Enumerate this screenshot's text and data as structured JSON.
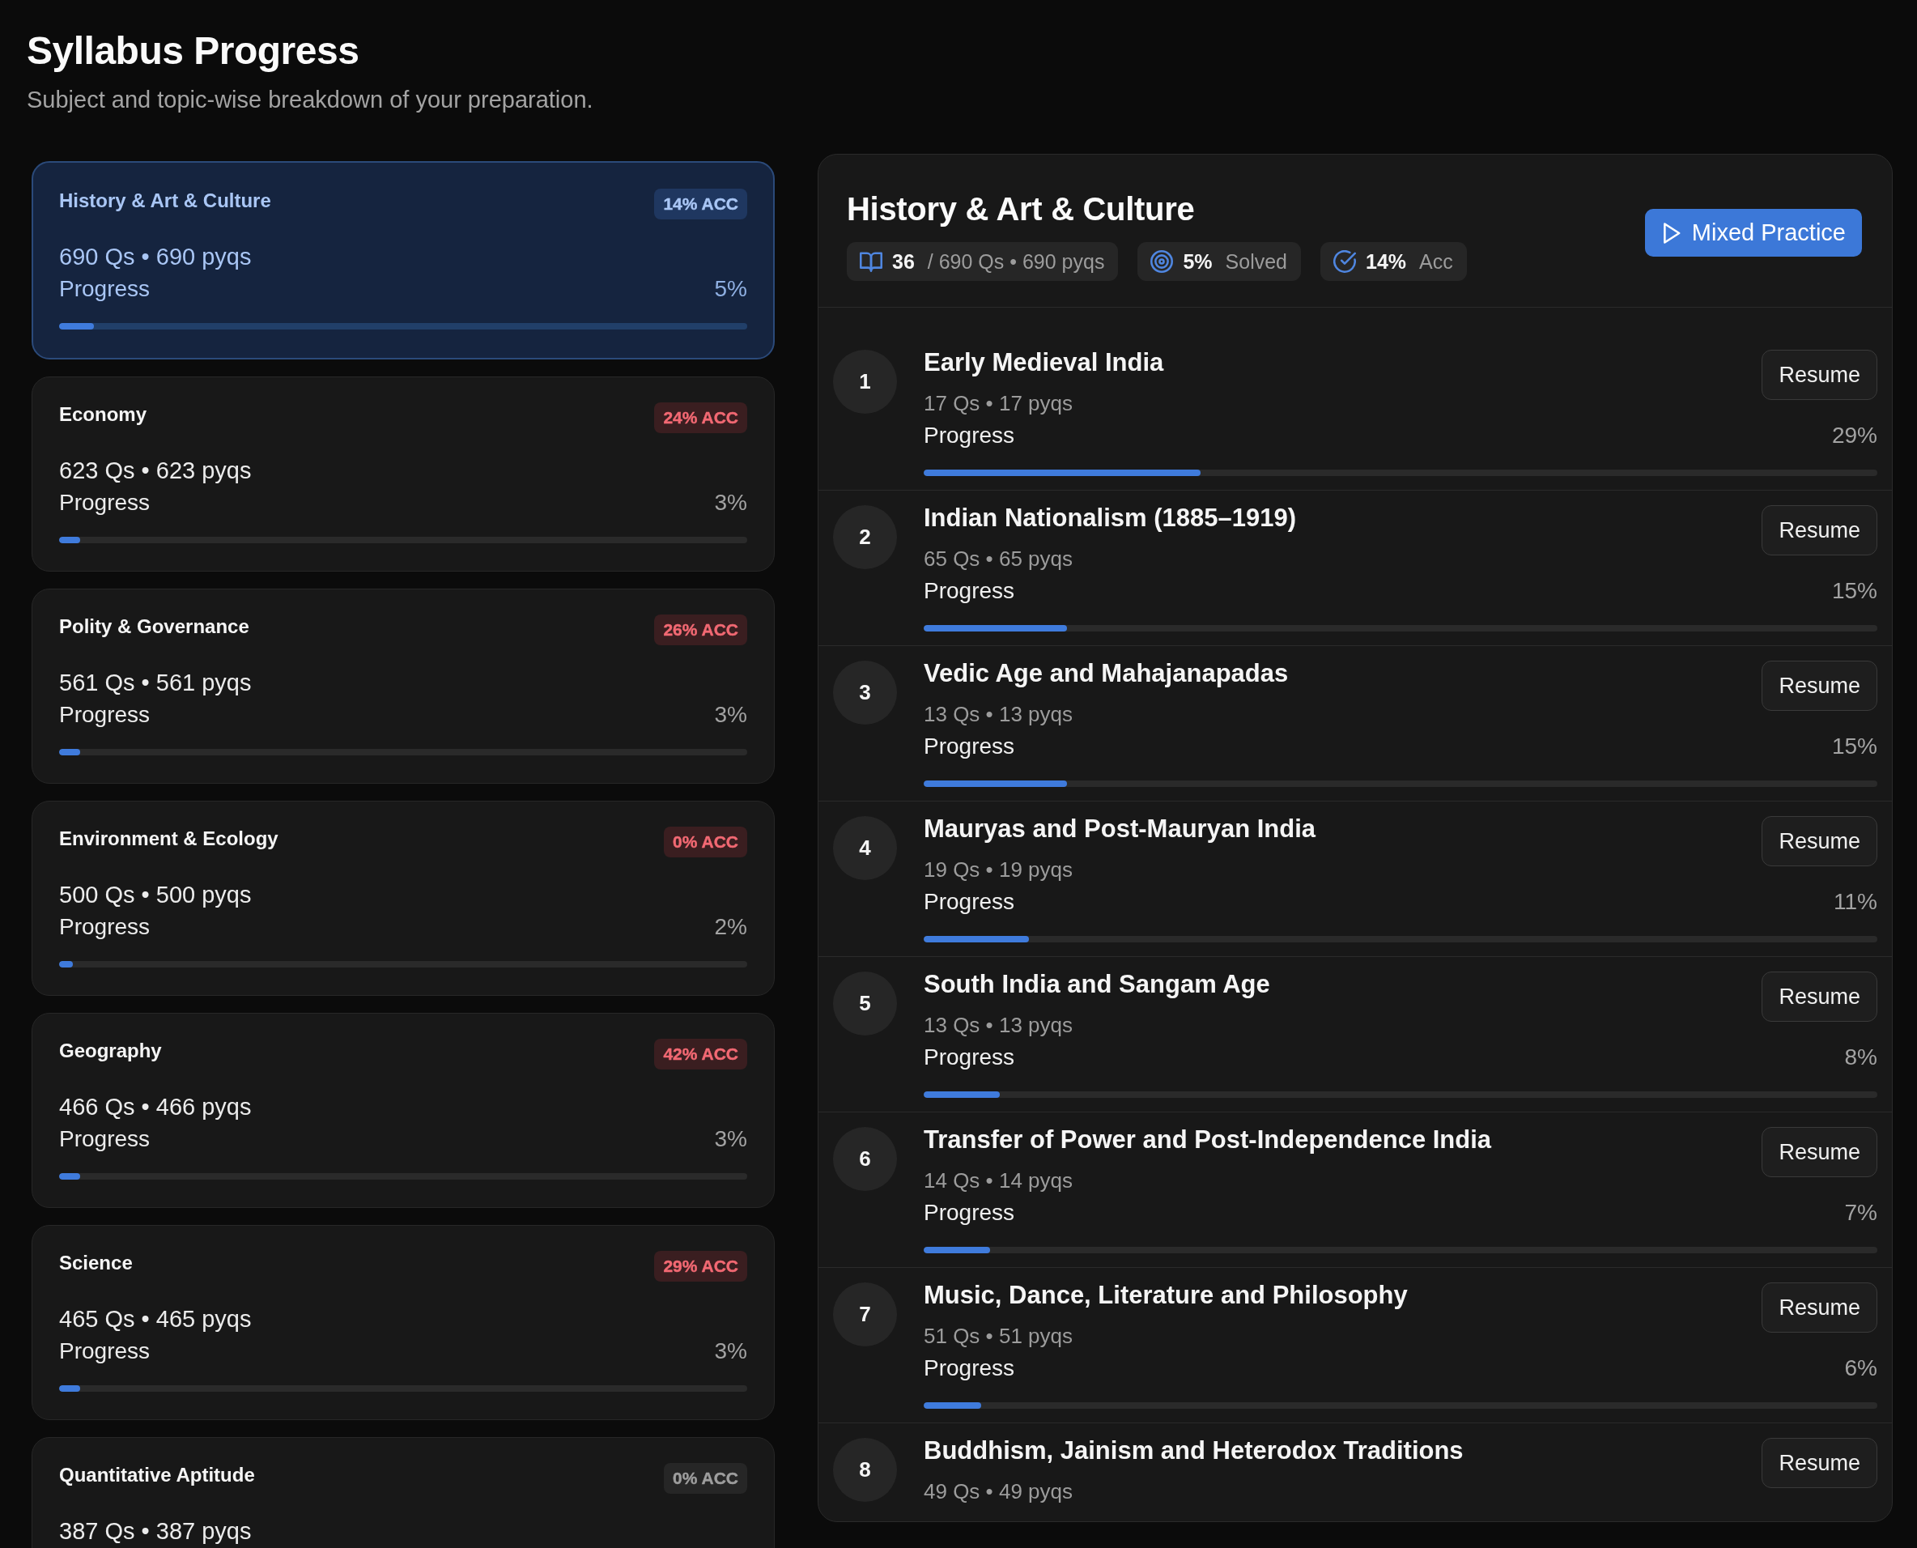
{
  "page": {
    "title": "Syllabus Progress",
    "subtitle": "Subject and topic-wise breakdown of your preparation."
  },
  "subjects": [
    {
      "name": "History & Art & Culture",
      "selected": true,
      "accuracy": {
        "text": "14% ACC",
        "color": "#1f3760"
      },
      "counts": "690 Qs • 690 pyqs",
      "progress_label": "Progress",
      "progress_value": "5%",
      "level": 0.05
    },
    {
      "name": "Economy",
      "selected": false,
      "accuracy": {
        "text": "24% ACC",
        "color": "#3a1e20"
      },
      "counts": "623 Qs • 623 pyqs",
      "progress_label": "Progress",
      "progress_value": "3%",
      "level": 0.03
    },
    {
      "name": "Polity & Governance",
      "selected": false,
      "accuracy": {
        "text": "26% ACC",
        "color": "#3a1e20"
      },
      "counts": "561 Qs • 561 pyqs",
      "progress_label": "Progress",
      "progress_value": "3%",
      "level": 0.03
    },
    {
      "name": "Environment & Ecology",
      "selected": false,
      "accuracy": {
        "text": "0% ACC",
        "color": "#3a1e20"
      },
      "counts": "500 Qs • 500 pyqs",
      "progress_label": "Progress",
      "progress_value": "2%",
      "level": 0.02
    },
    {
      "name": "Geography",
      "selected": false,
      "accuracy": {
        "text": "42% ACC",
        "color": "#3a1e20"
      },
      "counts": "466 Qs • 466 pyqs",
      "progress_label": "Progress",
      "progress_value": "3%",
      "level": 0.03
    },
    {
      "name": "Science",
      "selected": false,
      "accuracy": {
        "text": "29% ACC",
        "color": "#3a1e20"
      },
      "counts": "465 Qs • 465 pyqs",
      "progress_label": "Progress",
      "progress_value": "3%",
      "level": 0.03
    },
    {
      "name": "Quantitative Aptitude",
      "selected": false,
      "accuracy": {
        "text": "0% ACC",
        "color": "#262626"
      },
      "counts": "387 Qs • 387 pyqs"
    }
  ],
  "detail": {
    "title": "History & Art & Culture",
    "stats": [
      {
        "kind": "questions",
        "value": "36",
        "label": "/ 690 Qs • 690 pyqs"
      },
      {
        "kind": "solved",
        "value": "5%",
        "label": "Solved"
      },
      {
        "kind": "accuracy",
        "value": "14%",
        "label": "Acc"
      }
    ],
    "action": "Mixed Practice",
    "topics": [
      {
        "number": "1",
        "title": "Early Medieval India",
        "counts": "17 Qs • 17 pyqs",
        "progress_label": "Progress",
        "progress_value": "29%",
        "level": 0.29,
        "button": "Resume"
      },
      {
        "number": "2",
        "title": "Indian Nationalism (1885–1919)",
        "counts": "65 Qs • 65 pyqs",
        "progress_label": "Progress",
        "progress_value": "15%",
        "level": 0.15,
        "button": "Resume"
      },
      {
        "number": "3",
        "title": "Vedic Age and Mahajanapadas",
        "counts": "13 Qs • 13 pyqs",
        "progress_label": "Progress",
        "progress_value": "15%",
        "level": 0.15,
        "button": "Resume"
      },
      {
        "number": "4",
        "title": "Mauryas and Post-Mauryan India",
        "counts": "19 Qs • 19 pyqs",
        "progress_label": "Progress",
        "progress_value": "11%",
        "level": 0.11,
        "button": "Resume"
      },
      {
        "number": "5",
        "title": "South India and Sangam Age",
        "counts": "13 Qs • 13 pyqs",
        "progress_label": "Progress",
        "progress_value": "8%",
        "level": 0.08,
        "button": "Resume"
      },
      {
        "number": "6",
        "title": "Transfer of Power and Post-Independence India",
        "counts": "14 Qs • 14 pyqs",
        "progress_label": "Progress",
        "progress_value": "7%",
        "level": 0.07,
        "button": "Resume"
      },
      {
        "number": "7",
        "title": "Music, Dance, Literature and Philosophy",
        "counts": "51 Qs • 51 pyqs",
        "progress_label": "Progress",
        "progress_value": "6%",
        "level": 0.06,
        "button": "Resume"
      },
      {
        "number": "8",
        "title": "Buddhism, Jainism and Heterodox Traditions",
        "counts": "49 Qs • 49 pyqs",
        "button": "Resume"
      }
    ]
  }
}
